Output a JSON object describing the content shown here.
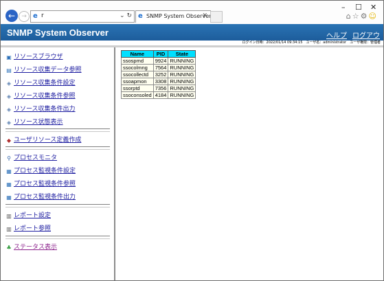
{
  "browser": {
    "url": "r",
    "tab_title": "SNMP System Observer",
    "window_controls": [
      "–",
      "☐",
      "✕"
    ],
    "tool_icons": [
      "home-icon",
      "star-icon",
      "gear-icon",
      "smiley-icon"
    ]
  },
  "header": {
    "title": "SNMP System Observer",
    "help_link": "ヘルプ",
    "logout_link": "ログアウト",
    "info": "ログイン日時：2022/01/14 09:34:15　ユーザ名：administrator　ユーザ権限：管理者"
  },
  "sidebar": {
    "items": [
      {
        "label": "リソースブラウザ",
        "icon": "browser-icon"
      },
      {
        "label": "リソース収集データ参照",
        "icon": "data-icon"
      },
      {
        "label": "リソース収集条件設定",
        "icon": "settings-icon"
      },
      {
        "label": "リソース収集条件参照",
        "icon": "settings-icon"
      },
      {
        "label": "リソース収集条件出力",
        "icon": "settings-icon"
      },
      {
        "label": "リソース状態表示",
        "icon": "status-icon"
      },
      {
        "label": "ユーザリソース定義作成",
        "icon": "user-resource-icon"
      },
      {
        "label": "プロセスモニタ",
        "icon": "magnifier-icon"
      },
      {
        "label": "プロセス監視条件設定",
        "icon": "process-icon"
      },
      {
        "label": "プロセス監視条件参照",
        "icon": "process-icon"
      },
      {
        "label": "プロセス監視条件出力",
        "icon": "process-icon"
      },
      {
        "label": "レポート設定",
        "icon": "report-icon"
      },
      {
        "label": "レポート参照",
        "icon": "report-icon"
      },
      {
        "label": "ステータス表示",
        "icon": "status-tree-icon"
      }
    ]
  },
  "process_table": {
    "headers": [
      "Name",
      "PID",
      "State"
    ],
    "rows": [
      [
        "ssospmd",
        "9924",
        "RUNNING"
      ],
      [
        "ssocolmng",
        "7564",
        "RUNNING"
      ],
      [
        "ssocollectd",
        "3252",
        "RUNNING"
      ],
      [
        "ssoapmon",
        "3308",
        "RUNNING"
      ],
      [
        "ssorptd",
        "7356",
        "RUNNING"
      ],
      [
        "ssoconsoled",
        "4184",
        "RUNNING"
      ]
    ]
  }
}
